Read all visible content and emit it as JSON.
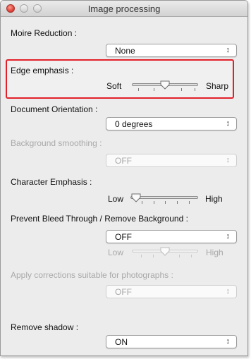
{
  "window": {
    "title": "Image processing"
  },
  "moire": {
    "label": "Moire Reduction :",
    "value": "None"
  },
  "edge": {
    "label": "Edge emphasis :",
    "left_label": "Soft",
    "right_label": "Sharp",
    "level": 0.5,
    "highlight_color": "#e3202a"
  },
  "orientation": {
    "label": "Document Orientation :",
    "value": "0 degrees"
  },
  "bg_smoothing": {
    "label": "Background smoothing :",
    "value": "OFF"
  },
  "char_emphasis": {
    "label": "Character Emphasis :",
    "left_label": "Low",
    "right_label": "High",
    "level": 0.0
  },
  "bleed": {
    "label": "Prevent Bleed Through / Remove Background :",
    "value": "OFF",
    "left_label": "Low",
    "right_label": "High",
    "level": 0.5
  },
  "photo": {
    "label": "Apply corrections suitable for photographs :",
    "value": "OFF"
  },
  "shadow": {
    "label": "Remove shadow :",
    "value": "ON"
  },
  "icons": {
    "select_arrows": "updown-arrows-icon",
    "slider_thumb": "triangle-thumb-icon"
  }
}
